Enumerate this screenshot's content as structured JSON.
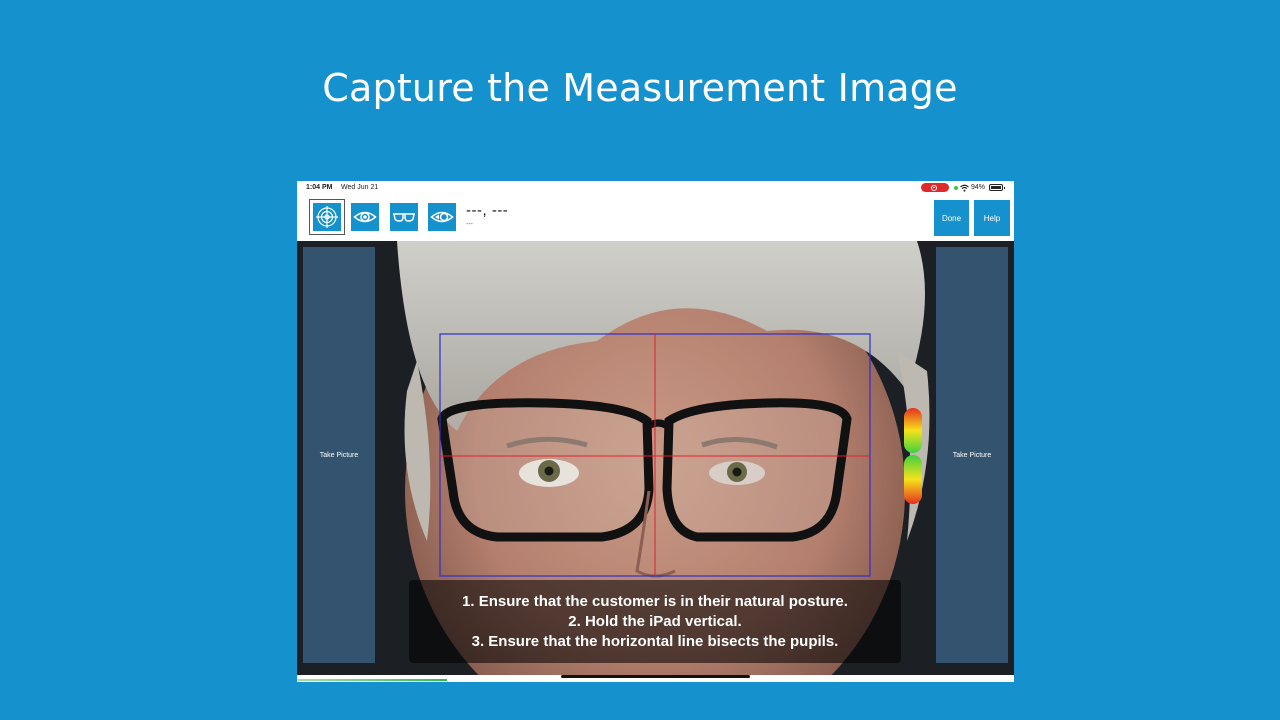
{
  "headline": "Capture the Measurement Image",
  "status_bar": {
    "time": "1:04 PM",
    "date": "Wed Jun 21",
    "battery": "94%",
    "record_color": "#e02a2a"
  },
  "toolbar": {
    "tools": [
      {
        "icon": "crosshair-target-icon",
        "selected": true
      },
      {
        "icon": "eye-icon",
        "selected": false
      },
      {
        "icon": "glasses-icon",
        "selected": false
      },
      {
        "icon": "eye-tracking-icon",
        "selected": false
      }
    ],
    "readout_main": "---, ---",
    "readout_sub": "---",
    "done_label": "Done",
    "help_label": "Help"
  },
  "camera": {
    "left_button": "Take Picture",
    "right_button": "Take Picture",
    "level_indicator_colors": [
      "#e53020",
      "#f6e21a",
      "#3fd13f"
    ]
  },
  "instructions": [
    "1. Ensure that the customer is in their natural posture.",
    "2. Hold the iPad vertical.",
    "3. Ensure that the horizontal line bisects the pupils."
  ],
  "colors": {
    "accent": "#1591cd",
    "panel": "#34536f"
  }
}
